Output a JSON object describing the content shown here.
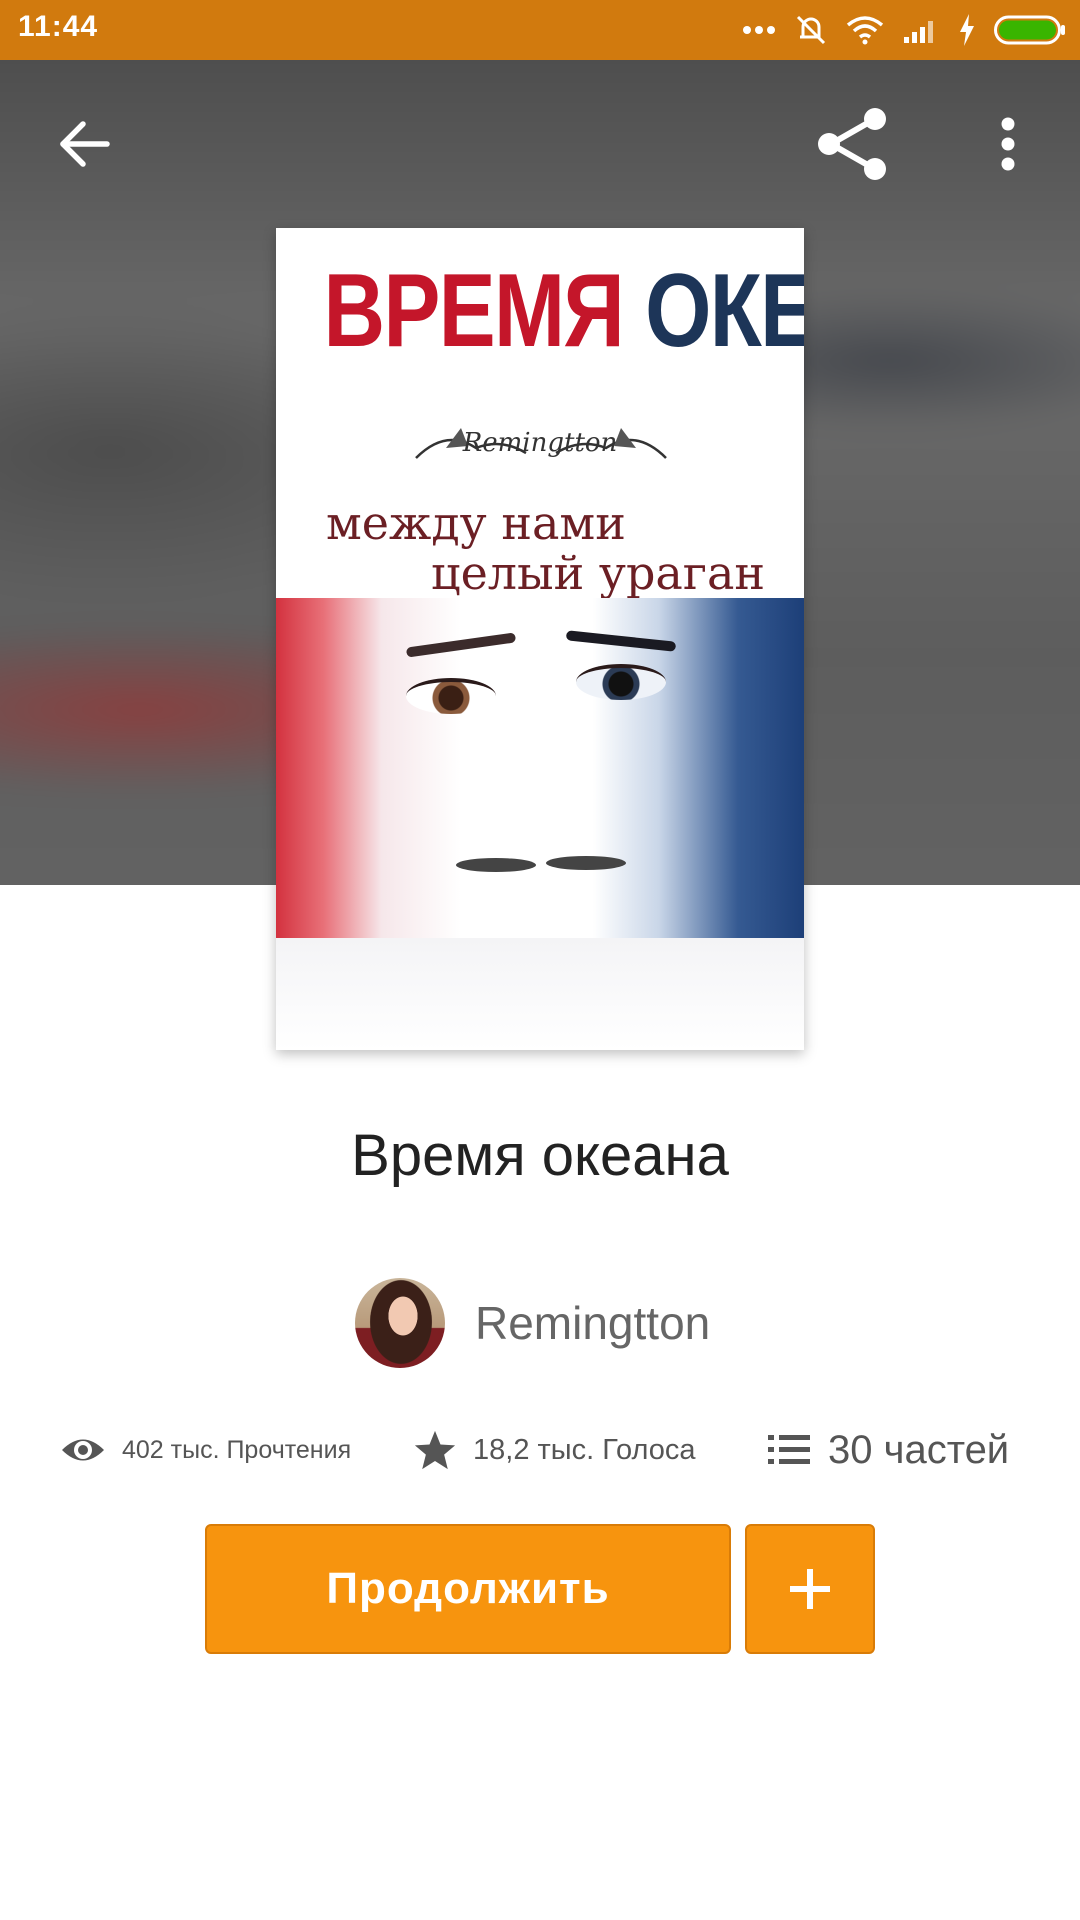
{
  "status_bar": {
    "time": "11:44",
    "icons": [
      "more-dots-icon",
      "mute-icon",
      "wifi-icon",
      "signal-icon",
      "charging-icon",
      "battery-icon"
    ]
  },
  "app_bar": {
    "back_icon": "arrow-left-icon",
    "share_icon": "share-icon",
    "more_icon": "more-vert-icon"
  },
  "cover": {
    "title_red": "ВРЕМЯ",
    "title_blue": "ОКЕАНА",
    "signature": "Remingtton",
    "subtitle_line1": "между нами",
    "subtitle_line2": "целый ураган"
  },
  "book": {
    "title": "Время океана",
    "author": "Remingtton"
  },
  "stats": {
    "reads": "402 тыс. Прочтения",
    "votes": "18,2 тыс. Голоса",
    "parts": "30 частей"
  },
  "actions": {
    "continue_label": "Продолжить",
    "add_label": "+"
  },
  "colors": {
    "status_bar": "#d17a0e",
    "accent": "#f7940e"
  }
}
